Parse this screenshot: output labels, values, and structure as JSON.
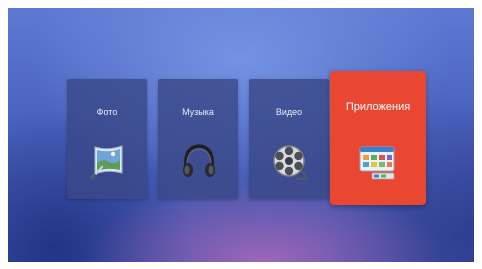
{
  "tiles": [
    {
      "label": "Фото",
      "icon": "photo-icon"
    },
    {
      "label": "Музыка",
      "icon": "headphones-icon"
    },
    {
      "label": "Видео",
      "icon": "film-reel-icon"
    },
    {
      "label": "Приложения",
      "icon": "apps-icon"
    }
  ],
  "selected_tile": "Приложения",
  "colors": {
    "accent": "#ea4733",
    "tile": "#3a4888",
    "background": "#4a63bd"
  }
}
